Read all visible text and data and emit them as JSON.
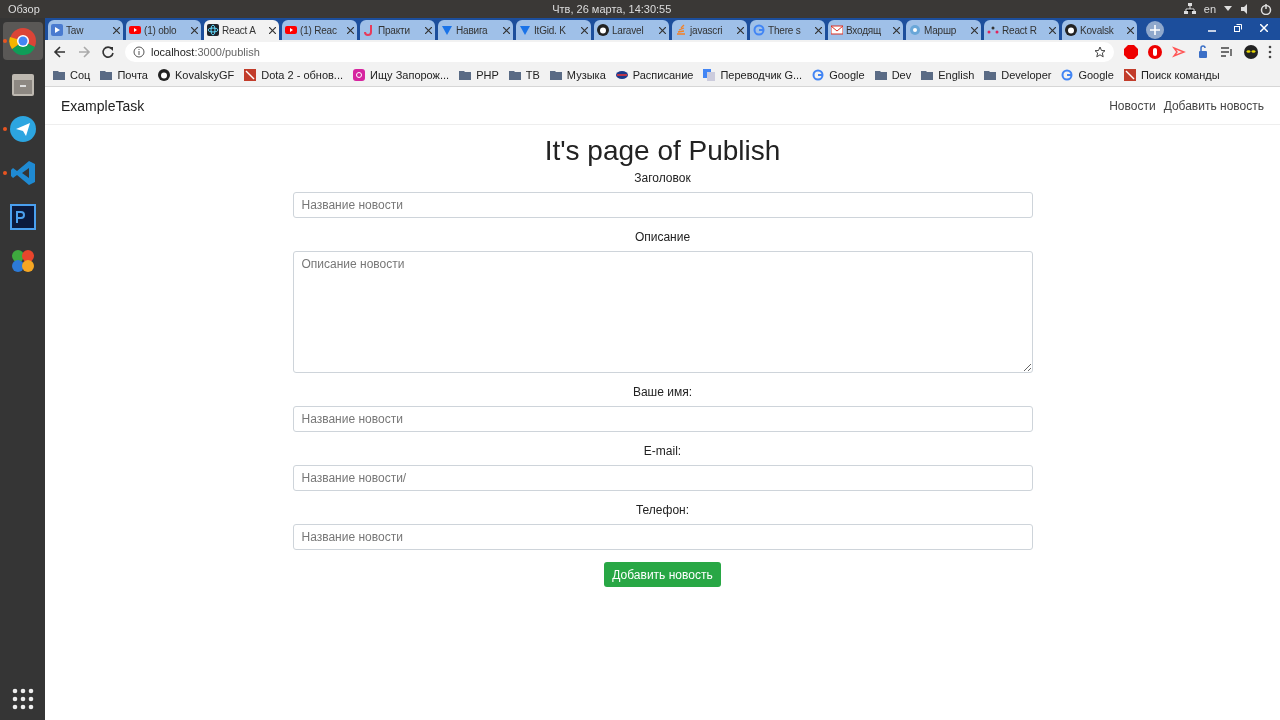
{
  "top_bar": {
    "activities": "Обзор",
    "clock": "Чтв, 26 марта, 14:30:55",
    "language": "en"
  },
  "dock": [
    {
      "kind": "chrome",
      "selected": true,
      "running": true
    },
    {
      "kind": "files",
      "selected": false,
      "running": false
    },
    {
      "kind": "telegram",
      "selected": false,
      "running": true
    },
    {
      "kind": "vscode",
      "selected": false,
      "running": true
    },
    {
      "kind": "photoshop",
      "selected": false,
      "running": false
    },
    {
      "kind": "clover",
      "selected": false,
      "running": false
    }
  ],
  "tabs": [
    {
      "label": "Taw",
      "kind": "play",
      "selected": false
    },
    {
      "label": "(1) oblo",
      "kind": "youtube",
      "selected": false
    },
    {
      "label": "React A",
      "kind": "react",
      "selected": true
    },
    {
      "label": "(1) Reac",
      "kind": "youtube",
      "selected": false
    },
    {
      "label": "Практи",
      "kind": "j",
      "selected": false
    },
    {
      "label": "Навига",
      "kind": "shield",
      "selected": false
    },
    {
      "label": "ItGid. K",
      "kind": "shield",
      "selected": false
    },
    {
      "label": "Laravel",
      "kind": "github",
      "selected": false
    },
    {
      "label": "javascri",
      "kind": "stack",
      "selected": false
    },
    {
      "label": "There s",
      "kind": "google",
      "selected": false
    },
    {
      "label": "Входящ",
      "kind": "gmail",
      "selected": false
    },
    {
      "label": "Маршр",
      "kind": "gear",
      "selected": false
    },
    {
      "label": "React R",
      "kind": "dots",
      "selected": false
    },
    {
      "label": "Kovalsk",
      "kind": "github",
      "selected": false
    }
  ],
  "address": {
    "host": "localhost",
    "path": ":3000/publish"
  },
  "bookmarks": [
    {
      "label": "Соц",
      "kind": "folder"
    },
    {
      "label": "Почта",
      "kind": "folder"
    },
    {
      "label": "KovalskyGF",
      "kind": "github"
    },
    {
      "label": "Dota 2 - обнов...",
      "kind": "dota"
    },
    {
      "label": "Ищу Запорож...",
      "kind": "instagram"
    },
    {
      "label": "PHP",
      "kind": "folder"
    },
    {
      "label": "ТВ",
      "kind": "folder"
    },
    {
      "label": "Музыка",
      "kind": "folder"
    },
    {
      "label": "Расписание",
      "kind": "rail"
    },
    {
      "label": "Переводчик G...",
      "kind": "translate"
    },
    {
      "label": "Google",
      "kind": "google"
    },
    {
      "label": "Dev",
      "kind": "folder"
    },
    {
      "label": "English",
      "kind": "folder"
    },
    {
      "label": "Developer",
      "kind": "folder"
    },
    {
      "label": "Google",
      "kind": "google"
    },
    {
      "label": "Поиск команды",
      "kind": "dota"
    }
  ],
  "navbar": {
    "brand": "ExampleTask",
    "links": [
      "Новости",
      "Добавить новость"
    ]
  },
  "heading": "It's page of Publish",
  "fields": [
    {
      "kind": "input",
      "label": "Заголовок",
      "placeholder": "Название новости"
    },
    {
      "kind": "textarea",
      "label": "Описание",
      "placeholder": "Описание новости"
    },
    {
      "kind": "input",
      "label": "Ваше имя:",
      "placeholder": "Название новости"
    },
    {
      "kind": "input",
      "label": "E-mail:",
      "placeholder": "Название новости/"
    },
    {
      "kind": "input",
      "label": "Телефон:",
      "placeholder": "Название новости"
    }
  ],
  "submit": "Добавить новость"
}
